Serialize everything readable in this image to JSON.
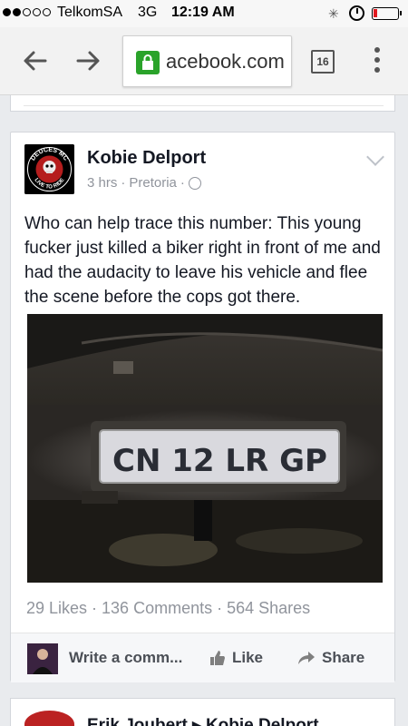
{
  "status": {
    "carrier": "TelkomSA",
    "network": "3G",
    "time": "12:19 AM",
    "signal_bars_filled": 2,
    "signal_bars_total": 5
  },
  "browser": {
    "url": "acebook.com",
    "tab_count": "16",
    "lock_color": "#2aa32a"
  },
  "post": {
    "author": "Kobie Delport",
    "time": "3 hrs",
    "location": "Pretoria",
    "separator": "·",
    "text": "Who can help trace this number: This young fucker just killed a biker right in front of me and had the audacity to leave his vehicle and flee the scene before the cops got there.",
    "photo": {
      "plate_text": "CN 12 LR GP"
    },
    "avatar_text": {
      "top": "DEUCES MC",
      "bottom": "LIVE TO RIDE"
    },
    "counts": "29 Likes · 136 Comments · 564 Shares",
    "actions": {
      "comment_label": "Write a comm...",
      "like_label": "Like",
      "share_label": "Share"
    }
  },
  "next_post": {
    "author": "Erik Joubert ▸ Kobie Delport"
  },
  "colors": {
    "accent": "#3b5998",
    "meta": "#90949c",
    "page_bg": "#e9ebee"
  }
}
